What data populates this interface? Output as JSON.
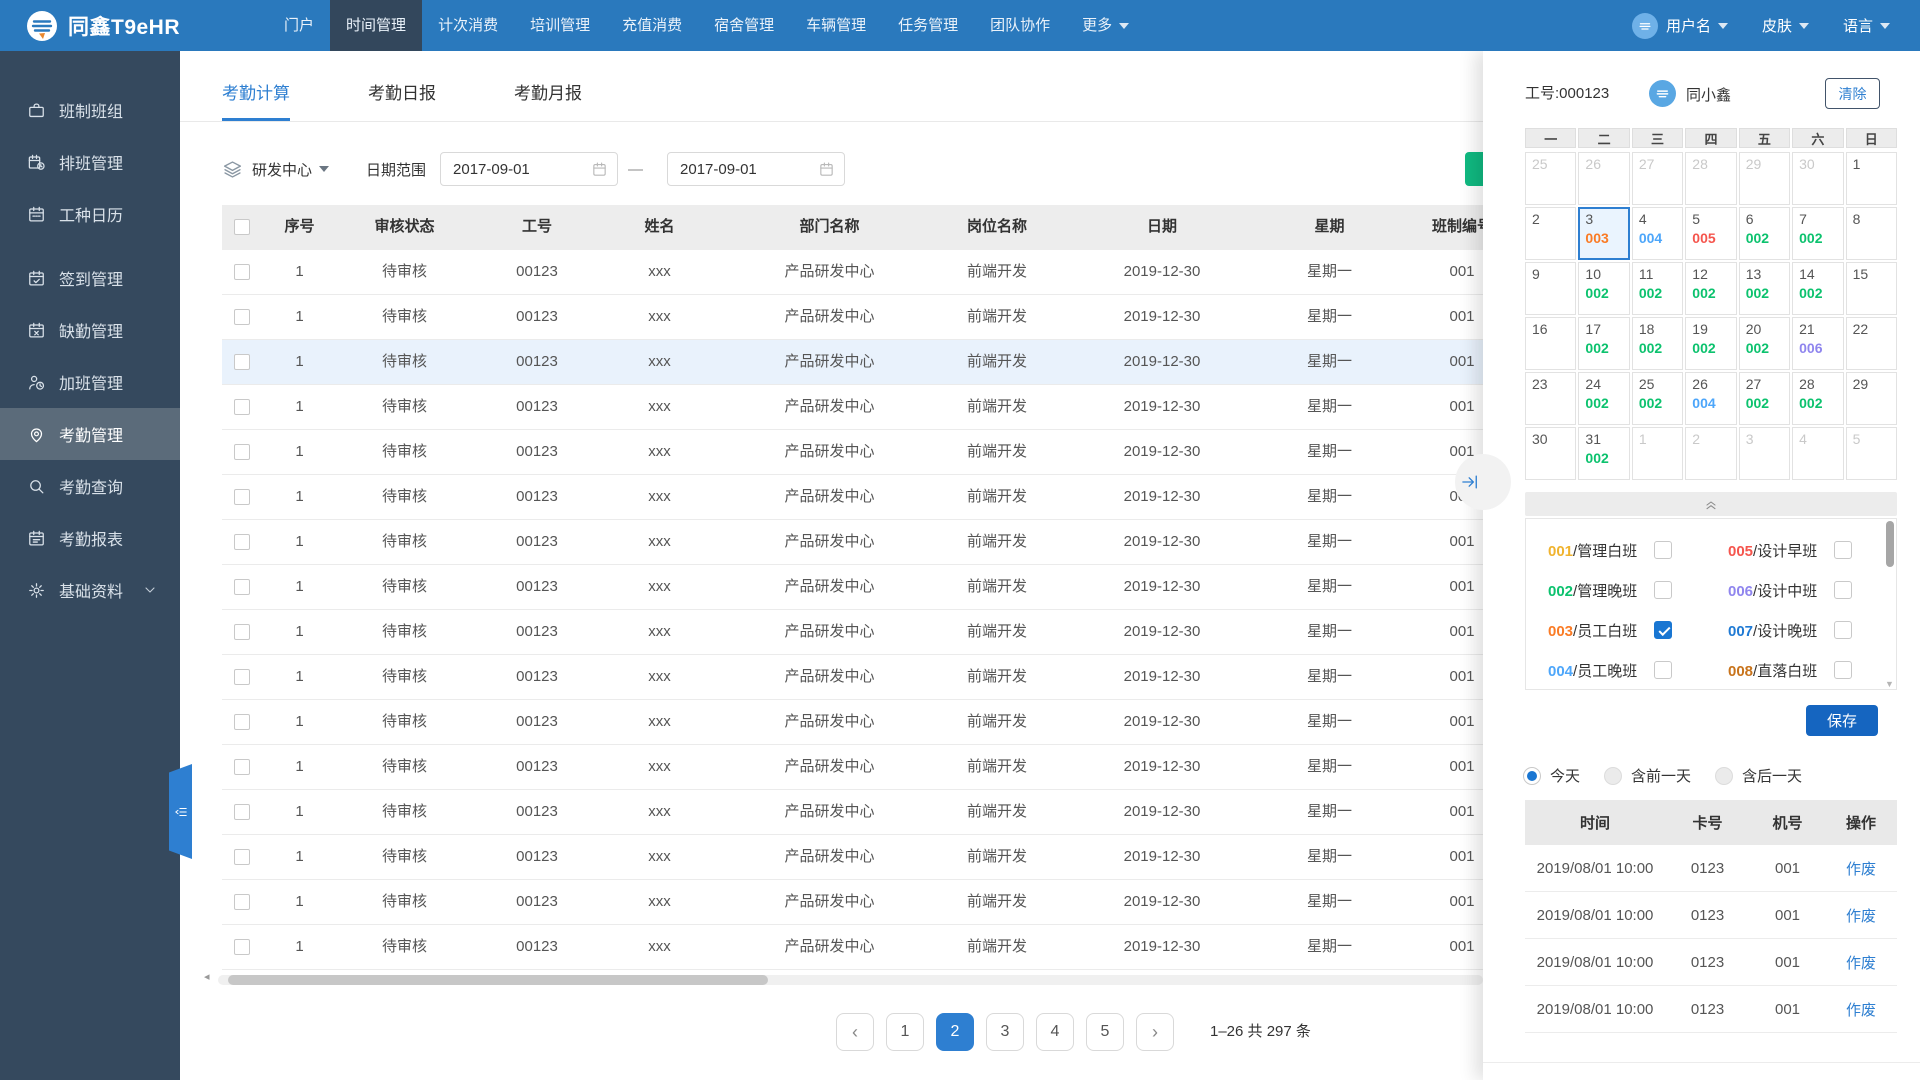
{
  "nav": {
    "brand": "同鑫T9eHR",
    "items": [
      {
        "label": "门户"
      },
      {
        "label": "时间管理",
        "active": true
      },
      {
        "label": "计次消费"
      },
      {
        "label": "培训管理"
      },
      {
        "label": "充值消费"
      },
      {
        "label": "宿舍管理"
      },
      {
        "label": "车辆管理"
      },
      {
        "label": "任务管理"
      },
      {
        "label": "团队协作"
      },
      {
        "label": "更多",
        "caret": true
      }
    ],
    "user_label": "用户名",
    "skin_label": "皮肤",
    "lang_label": "语言"
  },
  "sidebar": {
    "items": [
      {
        "label": "班制班组",
        "icon": "briefcase"
      },
      {
        "label": "排班管理",
        "icon": "calendar-clock"
      },
      {
        "label": "工种日历",
        "icon": "calendar"
      },
      {
        "label": "签到管理",
        "icon": "calendar-check",
        "gap": true
      },
      {
        "label": "缺勤管理",
        "icon": "calendar-x"
      },
      {
        "label": "加班管理",
        "icon": "user-clock"
      },
      {
        "label": "考勤管理",
        "icon": "map-pin",
        "active": true
      },
      {
        "label": "考勤查询",
        "icon": "search"
      },
      {
        "label": "考勤报表",
        "icon": "report-calendar"
      },
      {
        "label": "基础资料",
        "icon": "gear",
        "chevron": true
      }
    ]
  },
  "main": {
    "tabs": [
      {
        "label": "考勤计算",
        "active": true
      },
      {
        "label": "考勤日报"
      },
      {
        "label": "考勤月报"
      }
    ],
    "filter": {
      "dept": "研发中心",
      "date_range_label": "日期范围",
      "date_from": "2017-09-01",
      "date_to": "2017-09-01",
      "separator": "—"
    },
    "table": {
      "headers": [
        "序号",
        "审核状态",
        "工号",
        "姓名",
        "部门名称",
        "岗位名称",
        "日期",
        "星期",
        "班制编号"
      ],
      "row_template": [
        "1",
        "待审核",
        "00123",
        "xxx",
        "产品研发中心",
        "前端开发",
        "2019-12-30",
        "星期一",
        "001"
      ],
      "row_count": 16,
      "highlighted_row_index": 2
    },
    "pagination": {
      "prev_icon": "‹",
      "next_icon": "›",
      "pages": [
        "1",
        "2",
        "3",
        "4",
        "5"
      ],
      "active_page": "2",
      "summary": "1–26  共 297 条"
    }
  },
  "panel": {
    "employee_no_label": "工号:000123",
    "employee_name": "同小鑫",
    "clear_label": "清除",
    "calendar": {
      "weekdays": [
        "一",
        "二",
        "三",
        "四",
        "五",
        "六",
        "日"
      ],
      "cells": [
        {
          "day": "25",
          "muted": true
        },
        {
          "day": "26",
          "muted": true
        },
        {
          "day": "27",
          "muted": true
        },
        {
          "day": "28",
          "muted": true
        },
        {
          "day": "29",
          "muted": true
        },
        {
          "day": "30",
          "muted": true
        },
        {
          "day": "1"
        },
        {
          "day": "2"
        },
        {
          "day": "3",
          "code": "003",
          "selected": true
        },
        {
          "day": "4",
          "code": "004"
        },
        {
          "day": "5",
          "code": "005"
        },
        {
          "day": "6",
          "code": "002"
        },
        {
          "day": "7",
          "code": "002"
        },
        {
          "day": "8"
        },
        {
          "day": "9"
        },
        {
          "day": "10",
          "code": "002"
        },
        {
          "day": "11",
          "code": "002"
        },
        {
          "day": "12",
          "code": "002"
        },
        {
          "day": "13",
          "code": "002"
        },
        {
          "day": "14",
          "code": "002"
        },
        {
          "day": "15"
        },
        {
          "day": "16"
        },
        {
          "day": "17",
          "code": "002"
        },
        {
          "day": "18",
          "code": "002"
        },
        {
          "day": "19",
          "code": "002"
        },
        {
          "day": "20",
          "code": "002"
        },
        {
          "day": "21",
          "code": "006"
        },
        {
          "day": "22"
        },
        {
          "day": "23"
        },
        {
          "day": "24",
          "code": "002"
        },
        {
          "day": "25",
          "code": "002"
        },
        {
          "day": "26",
          "code": "004"
        },
        {
          "day": "27",
          "code": "002"
        },
        {
          "day": "28",
          "code": "002"
        },
        {
          "day": "29"
        },
        {
          "day": "30"
        },
        {
          "day": "31",
          "code": "002"
        },
        {
          "day": "1",
          "muted": true
        },
        {
          "day": "2",
          "muted": true
        },
        {
          "day": "3",
          "muted": true
        },
        {
          "day": "4",
          "muted": true
        },
        {
          "day": "5",
          "muted": true
        }
      ]
    },
    "shifts": [
      {
        "code": "001",
        "name": "管理白班",
        "checked": false
      },
      {
        "code": "002",
        "name": "管理晚班",
        "checked": false
      },
      {
        "code": "003",
        "name": "员工白班",
        "checked": true
      },
      {
        "code": "004",
        "name": "员工晚班",
        "checked": false
      },
      {
        "code": "005",
        "name": "设计早班",
        "checked": false
      },
      {
        "code": "006",
        "name": "设计中班",
        "checked": false
      },
      {
        "code": "007",
        "name": "设计晚班",
        "checked": false
      },
      {
        "code": "008",
        "name": "直落白班",
        "checked": false
      }
    ],
    "shift_separator": "/",
    "save_label": "保存",
    "radios": [
      {
        "label": "今天",
        "selected": true
      },
      {
        "label": "含前一天",
        "selected": false
      },
      {
        "label": "含后一天",
        "selected": false
      }
    ],
    "log_table": {
      "headers": [
        "时间",
        "卡号",
        "机号",
        "操作"
      ],
      "rows": [
        {
          "time": "2019/08/01 10:00",
          "card": "0123",
          "machine": "001",
          "action": "作废"
        },
        {
          "time": "2019/08/01 10:00",
          "card": "0123",
          "machine": "001",
          "action": "作废"
        },
        {
          "time": "2019/08/01 10:00",
          "card": "0123",
          "machine": "001",
          "action": "作废"
        },
        {
          "time": "2019/08/01 10:00",
          "card": "0123",
          "machine": "001",
          "action": "作废"
        }
      ]
    }
  },
  "colors": {
    "accent": "#2e7fd1",
    "nav_bg": "#2a79bd",
    "nav_active_bg": "#33475c",
    "sidebar_bg": "#35495e",
    "sidebar_active_bg": "#5b6b7a",
    "green_button": "#10b981",
    "save_button": "#1565c0",
    "row_highlight": "#e9f2fc",
    "shift_codes": {
      "001": "#f0b32e",
      "002": "#0cc26e",
      "003": "#fa7b25",
      "004": "#4da6fa",
      "005": "#f5554d",
      "006": "#8f85ee",
      "007": "#1f7ad4",
      "008": "#c8731b"
    }
  }
}
